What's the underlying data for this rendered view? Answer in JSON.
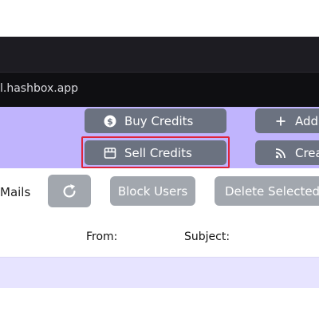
{
  "browser": {
    "url_text": "l.hashbox.app"
  },
  "header": {
    "buy_credits_label": "Buy Credits",
    "sell_credits_label": "Sell Credits",
    "add_label": "Add",
    "create_label": "Crea"
  },
  "toolbar": {
    "mails_label": "Mails",
    "block_users_label": "Block Users",
    "delete_selected_label": "Delete Selected"
  },
  "table": {
    "columns": [
      "From:",
      "Subject:"
    ]
  },
  "icons": {
    "buy": "dollar-coin-icon",
    "sell": "store-icon",
    "add": "plus-icon",
    "create": "rss-icon",
    "refresh": "refresh-icon"
  },
  "colors": {
    "header_background": "#c0b4fd",
    "dark_button": "#6b7280",
    "light_button": "#a2a7ae",
    "highlight_border": "#e0243a",
    "row_background": "#e7e4ff"
  }
}
